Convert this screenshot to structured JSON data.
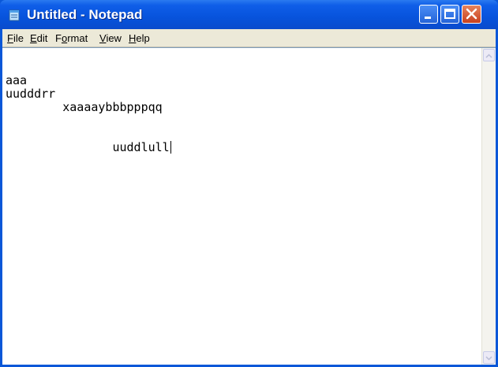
{
  "window": {
    "title": "Untitled - Notepad"
  },
  "menu": [
    {
      "key": "file",
      "label": "File"
    },
    {
      "key": "edit",
      "label": "Edit"
    },
    {
      "key": "format",
      "label": "Format"
    },
    {
      "key": "view",
      "label": "View"
    },
    {
      "key": "help",
      "label": "Help"
    }
  ],
  "editor": {
    "lines": [
      "aaa",
      "uudddrr",
      "        xaaaaybbbpppqq",
      "",
      "",
      "               uuddlull"
    ]
  },
  "colors": {
    "titlebar": "#0753dc",
    "menubar": "#ece9d8",
    "close_button": "#c8401f"
  },
  "icons": {
    "app": "notepad-icon",
    "minimize": "minimize-icon",
    "maximize": "maximize-icon",
    "close": "close-icon",
    "scroll_up": "scroll-up-arrow",
    "scroll_down": "scroll-down-arrow"
  }
}
